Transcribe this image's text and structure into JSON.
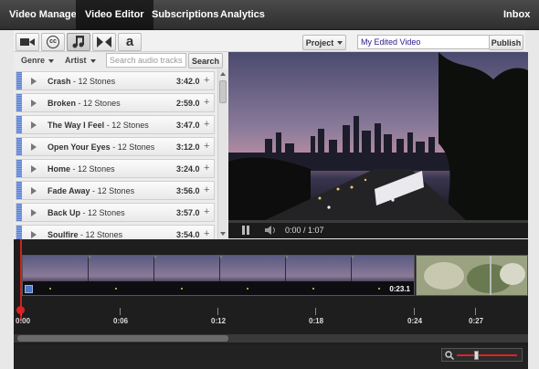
{
  "topnav": {
    "tabs": [
      {
        "label": "Video Manager"
      },
      {
        "label": "Video Editor"
      },
      {
        "label": "Subscriptions"
      },
      {
        "label": "Analytics"
      }
    ],
    "inbox": "Inbox"
  },
  "toolbar": {
    "tools": [
      "video-camera-icon",
      "cc-icon",
      "music-note-icon",
      "transitions-icon",
      "text-icon"
    ],
    "cc_label": "cc",
    "text_label": "a",
    "project_label": "Project",
    "project_name": "My Edited Video",
    "publish_label": "Publish"
  },
  "filters": {
    "genre": "Genre",
    "artist": "Artist",
    "search_placeholder": "Search audio tracks",
    "search_label": "Search"
  },
  "tracks": [
    {
      "title": "Crash",
      "artist": "12 Stones",
      "duration": "3:42.0"
    },
    {
      "title": "Broken",
      "artist": "12 Stones",
      "duration": "2:59.0"
    },
    {
      "title": "The Way I Feel",
      "artist": "12 Stones",
      "duration": "3:47.0"
    },
    {
      "title": "Open Your Eyes",
      "artist": "12 Stones",
      "duration": "3:12.0"
    },
    {
      "title": "Home",
      "artist": "12 Stones",
      "duration": "3:24.0"
    },
    {
      "title": "Fade Away",
      "artist": "12 Stones",
      "duration": "3:56.0"
    },
    {
      "title": "Back Up",
      "artist": "12 Stones",
      "duration": "3:57.0"
    },
    {
      "title": "Soulfire",
      "artist": "12 Stones",
      "duration": "3:54.0"
    }
  ],
  "track_separator": "-",
  "plus_symbol": "+",
  "player": {
    "time": "0:00 / 1:07",
    "progress": 0.0
  },
  "timeline": {
    "clip_duration": "0:23.1",
    "ticks": [
      "0:00",
      "0:06",
      "0:12",
      "0:18",
      "0:24",
      "0:27"
    ]
  },
  "colors": {
    "nav_bg": "#3a3a3a",
    "accent_red": "#d22",
    "grip_blue": "#5a7fd0",
    "project_text": "#2b1a8a"
  }
}
